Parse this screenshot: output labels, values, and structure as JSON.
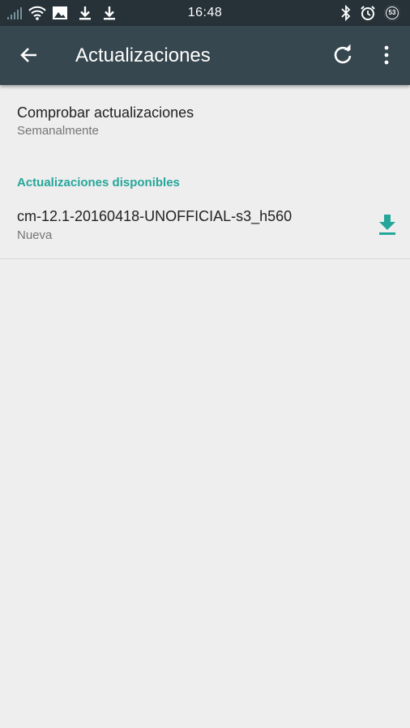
{
  "status_bar": {
    "time": "16:48",
    "battery": "53",
    "icons": [
      "signal-icon",
      "wifi-icon",
      "image-icon",
      "download-icon",
      "download-icon",
      "bluetooth-icon",
      "alarm-icon",
      "battery-icon"
    ]
  },
  "app_bar": {
    "title": "Actualizaciones",
    "back_icon": "arrow-back-icon",
    "refresh_icon": "refresh-icon",
    "menu_icon": "more-vert-icon",
    "color": "#37474f"
  },
  "settings": {
    "check_updates": {
      "title": "Comprobar actualizaciones",
      "summary": "Semanalmente"
    },
    "available_header": "Actualizaciones disponibles",
    "updates": [
      {
        "name": "cm-12.1-20160418-UNOFFICIAL-s3_h560",
        "status": "Nueva",
        "action_icon": "download-icon"
      }
    ]
  },
  "colors": {
    "accent": "#26a69a",
    "background": "#eeeeee",
    "status_bar": "#263238"
  }
}
